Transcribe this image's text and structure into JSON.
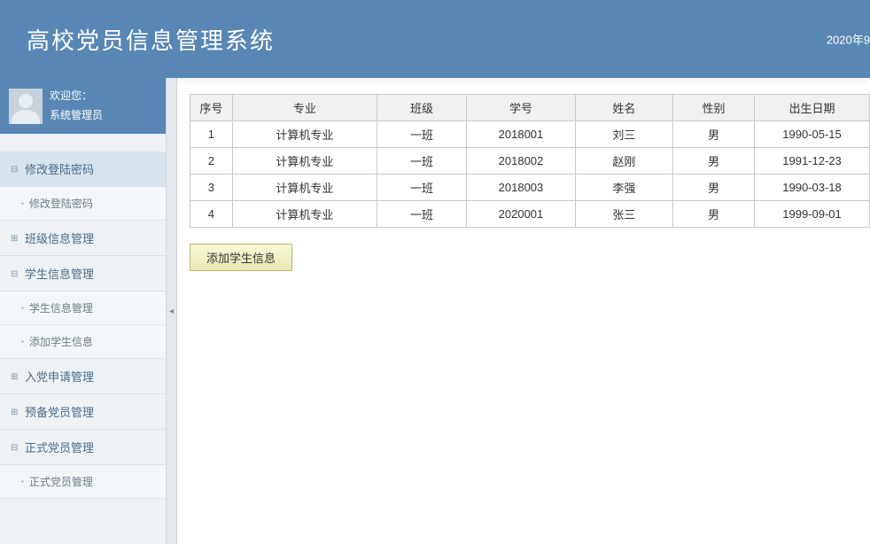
{
  "header": {
    "title": "高校党员信息管理系统",
    "date": "2020年9"
  },
  "user": {
    "welcome": "欢迎您：",
    "role": "系统管理员"
  },
  "nav": {
    "items": [
      {
        "label": "修改登陆密码",
        "expanded": true,
        "icon": "⊟",
        "subs": [
          "修改登陆密码"
        ]
      },
      {
        "label": "班级信息管理",
        "expanded": false,
        "icon": "⊞",
        "subs": []
      },
      {
        "label": "学生信息管理",
        "expanded": true,
        "icon": "⊟",
        "subs": [
          "学生信息管理",
          "添加学生信息"
        ]
      },
      {
        "label": "入党申请管理",
        "expanded": false,
        "icon": "⊞",
        "subs": []
      },
      {
        "label": "预备党员管理",
        "expanded": false,
        "icon": "⊞",
        "subs": []
      },
      {
        "label": "正式党员管理",
        "expanded": true,
        "icon": "⊟",
        "subs": [
          "正式党员管理"
        ]
      }
    ]
  },
  "table": {
    "headers": [
      "序号",
      "专业",
      "班级",
      "学号",
      "姓名",
      "性别",
      "出生日期"
    ],
    "rows": [
      [
        "1",
        "计算机专业",
        "一班",
        "2018001",
        "刘三",
        "男",
        "1990-05-15"
      ],
      [
        "2",
        "计算机专业",
        "一班",
        "2018002",
        "赵刚",
        "男",
        "1991-12-23"
      ],
      [
        "3",
        "计算机专业",
        "一班",
        "2018003",
        "李强",
        "男",
        "1990-03-18"
      ],
      [
        "4",
        "计算机专业",
        "一班",
        "2020001",
        "张三",
        "男",
        "1999-09-01"
      ]
    ]
  },
  "buttons": {
    "add_student": "添加学生信息"
  }
}
